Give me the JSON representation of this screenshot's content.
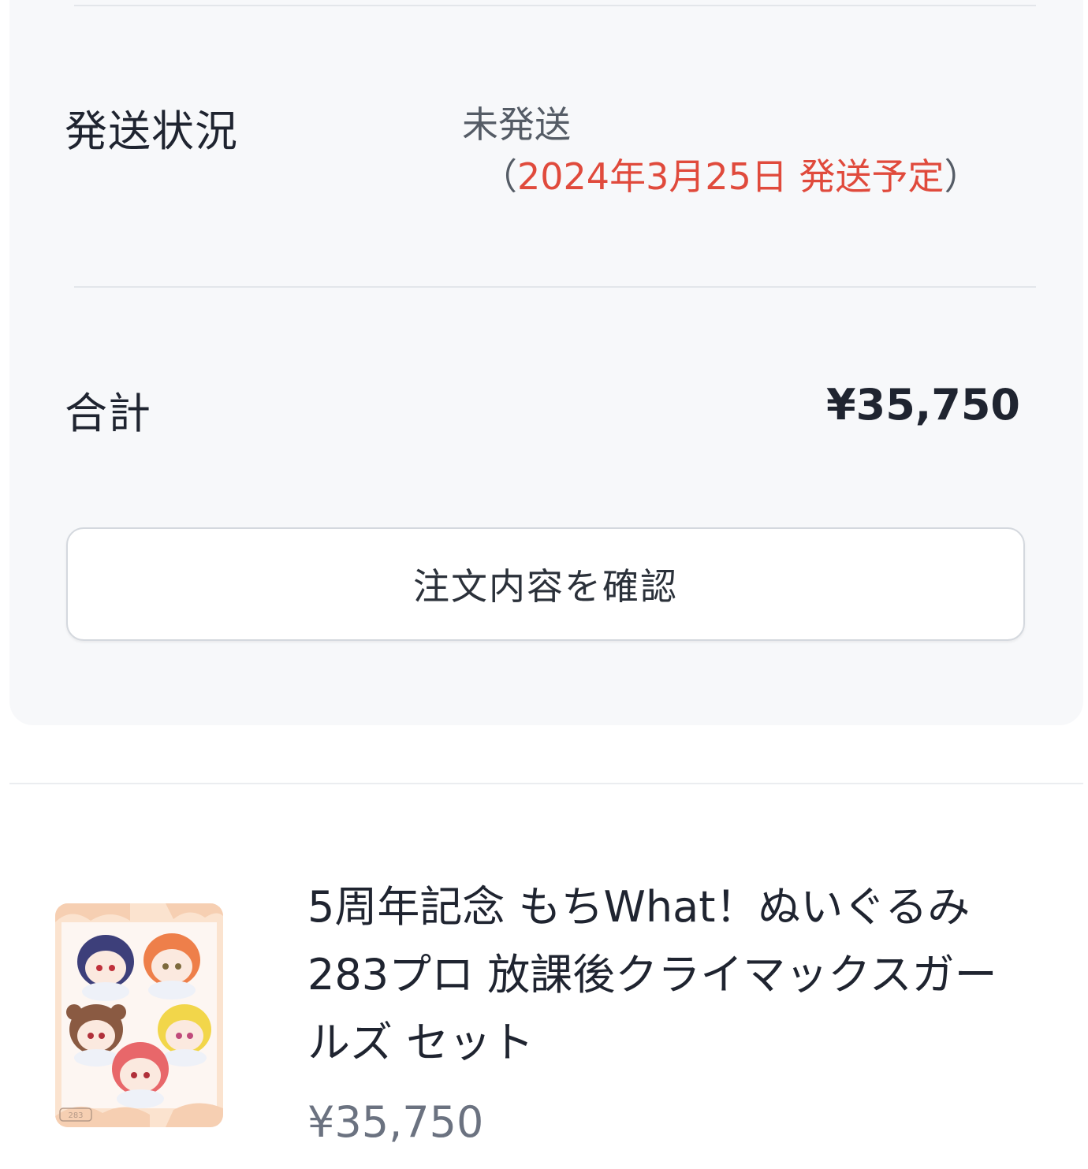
{
  "shipping": {
    "label": "発送状況",
    "status": "未発送",
    "paren_open": "（",
    "scheduled": "2024年3月25日 発送予定",
    "paren_close": "）"
  },
  "total": {
    "label": "合計",
    "value": "¥35,750"
  },
  "confirm_button": {
    "label": "注文内容を確認"
  },
  "item": {
    "title": "5周年記念 もちWhat！ぬいぐるみ 283プロ 放課後クライマックスガールズ セット",
    "price": "¥35,750",
    "thumbnail_badge": "283"
  },
  "colors": {
    "accent_red": "#e04a3c",
    "card_bg": "#f7f8fa"
  }
}
